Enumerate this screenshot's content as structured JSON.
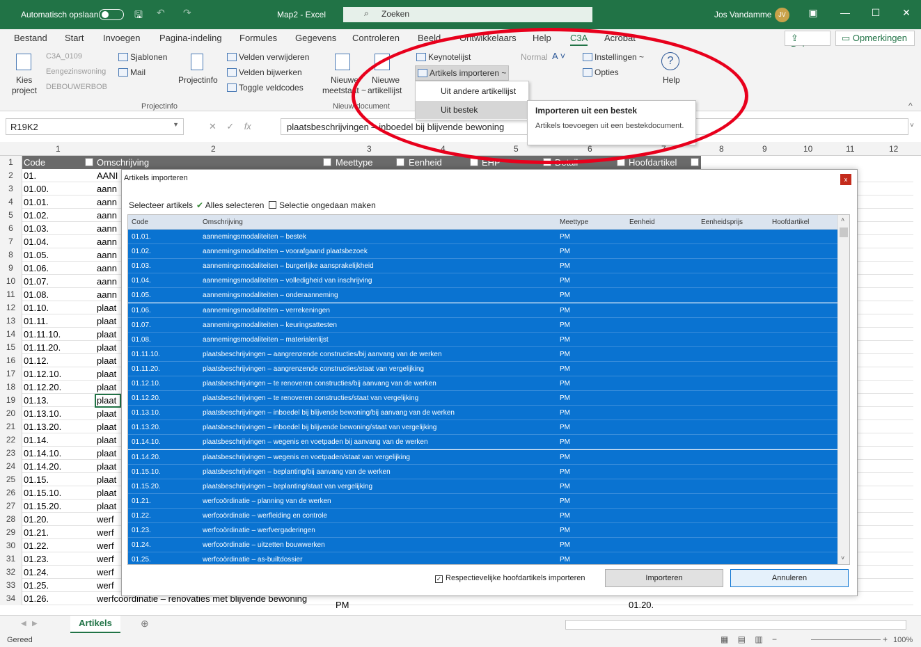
{
  "titlebar": {
    "autosave": "Automatisch opslaan",
    "filename": "Map2 - Excel",
    "search": "Zoeken",
    "user": "Jos Vandamme",
    "initials": "JV"
  },
  "menu": [
    "Bestand",
    "Start",
    "Invoegen",
    "Pagina-indeling",
    "Formules",
    "Gegevens",
    "Controleren",
    "Beeld",
    "Ontwikkelaars",
    "Help",
    "C3A",
    "Acrobat"
  ],
  "share": "Delen",
  "comments": "Opmerkingen",
  "ribbon": {
    "kies": "Kies",
    "project": "project",
    "proj_lines": [
      "C3A_0109",
      "Eengezinswoning",
      "DEBOUWERBOB"
    ],
    "sjablonen": "Sjablonen",
    "mail": "Mail",
    "projectinfo": "Projectinfo",
    "velden_verwijderen": "Velden verwijderen",
    "velden_bijwerken": "Velden bijwerken",
    "toggle": "Toggle veldcodes",
    "grp_projectinfo": "Projectinfo",
    "nieuwe_meetstaat": [
      "Nieuwe",
      "meetstaat ~"
    ],
    "nieuwe_artikellijst": [
      "Nieuwe",
      "artikellijst"
    ],
    "grp_nieuw": "Nieuw document",
    "keynotelijst": "Keynotelijst",
    "artikels_importeren": "Artikels importeren ~",
    "normal": "Normal",
    "instellingen": "Instellingen ~",
    "opties": "Opties",
    "help": "Help"
  },
  "dropdown": [
    "Uit andere artikellijst",
    "Uit bestek"
  ],
  "tooltip": {
    "title": "Importeren uit een bestek",
    "body": "Artikels toevoegen uit een bestekdocument."
  },
  "formula": {
    "namebox": "R19K2",
    "content": "plaatsbeschrijvingen – inboedel bij blijvende bewoning"
  },
  "columns": [
    "1",
    "2",
    "3",
    "4",
    "5",
    "6",
    "7",
    "8",
    "9",
    "10",
    "11",
    "12"
  ],
  "headers": [
    "Code",
    "Omschrijving",
    "Meettype",
    "Eenheid",
    "EHP",
    "Detail",
    "Hoofdartikel"
  ],
  "rows": [
    [
      "01.",
      "AANI"
    ],
    [
      "01.00.",
      "aann"
    ],
    [
      "01.01.",
      "aann"
    ],
    [
      "01.02.",
      "aann"
    ],
    [
      "01.03.",
      "aann"
    ],
    [
      "01.04.",
      "aann"
    ],
    [
      "01.05.",
      "aann"
    ],
    [
      "01.06.",
      "aann"
    ],
    [
      "01.07.",
      "aann"
    ],
    [
      "01.08.",
      "aann"
    ],
    [
      "01.10.",
      "plaat"
    ],
    [
      "01.11.",
      "plaat"
    ],
    [
      "01.11.10.",
      "plaat"
    ],
    [
      "01.11.20.",
      "plaat"
    ],
    [
      "01.12.",
      "plaat"
    ],
    [
      "01.12.10.",
      "plaat"
    ],
    [
      "01.12.20.",
      "plaat"
    ],
    [
      "01.13.",
      "plaat"
    ],
    [
      "01.13.10.",
      "plaat"
    ],
    [
      "01.13.20.",
      "plaat"
    ],
    [
      "01.14.",
      "plaat"
    ],
    [
      "01.14.10.",
      "plaat"
    ],
    [
      "01.14.20.",
      "plaat"
    ],
    [
      "01.15.",
      "plaat"
    ],
    [
      "01.15.10.",
      "plaat"
    ],
    [
      "01.15.20.",
      "plaat"
    ],
    [
      "01.20.",
      "werf"
    ],
    [
      "01.21.",
      "werf"
    ],
    [
      "01.22.",
      "werf"
    ],
    [
      "01.23.",
      "werf"
    ],
    [
      "01.24.",
      "werf"
    ],
    [
      "01.25.",
      "werf"
    ],
    [
      "01.26.",
      "werfcoördinatie – renovaties met blijvende bewoning"
    ]
  ],
  "row34": {
    "meettype": "PM",
    "hoofd": "01.20."
  },
  "sheet": {
    "tab": "Artikels",
    "status": "Gereed",
    "zoom": "100%"
  },
  "dialog": {
    "title": "Artikels importeren",
    "close": "x",
    "selecteer": "Selecteer artikels",
    "alles": "Alles selecteren",
    "ongedaan": "Selectie ongedaan maken",
    "cols": [
      "Code",
      "Omschrijving",
      "Meettype",
      "Eenheid",
      "Eenheidsprijs",
      "Hoofdartikel"
    ],
    "items": [
      [
        "01.01.",
        "aannemingsmodaliteiten – bestek",
        "PM"
      ],
      [
        "01.02.",
        "aannemingsmodaliteiten – voorafgaand plaatsbezoek",
        "PM"
      ],
      [
        "01.03.",
        "aannemingsmodaliteiten – burgerlijke aansprakelijkheid",
        "PM"
      ],
      [
        "01.04.",
        "aannemingsmodaliteiten – volledigheid van inschrijving",
        "PM"
      ],
      [
        "01.05.",
        "aannemingsmodaliteiten – onderaanneming",
        "PM"
      ],
      [
        "01.06.",
        "aannemingsmodaliteiten – verrekeningen",
        "PM"
      ],
      [
        "01.07.",
        "aannemingsmodaliteiten – keuringsattesten",
        "PM"
      ],
      [
        "01.08.",
        "aannemingsmodaliteiten – materialenlijst",
        "PM"
      ],
      [
        "01.11.10.",
        "plaatsbeschrijvingen – aangrenzende constructies/bij aanvang van de werken",
        "PM"
      ],
      [
        "01.11.20.",
        "plaatsbeschrijvingen – aangrenzende constructies/staat van vergelijking",
        "PM"
      ],
      [
        "01.12.10.",
        "plaatsbeschrijvingen – te renoveren constructies/bij aanvang van de werken",
        "PM"
      ],
      [
        "01.12.20.",
        "plaatsbeschrijvingen – te renoveren constructies/staat van vergelijking",
        "PM"
      ],
      [
        "01.13.10.",
        "plaatsbeschrijvingen – inboedel bij blijvende bewoning/bij aanvang van de werken",
        "PM"
      ],
      [
        "01.13.20.",
        "plaatsbeschrijvingen – inboedel bij blijvende bewoning/staat van vergelijking",
        "PM"
      ],
      [
        "01.14.10.",
        "plaatsbeschrijvingen – wegenis en voetpaden bij aanvang van de werken",
        "PM"
      ],
      [
        "01.14.20.",
        "plaatsbeschrijvingen – wegenis en voetpaden/staat van vergelijking",
        "PM"
      ],
      [
        "01.15.10.",
        "plaatsbeschrijvingen – beplanting/bij aanvang van de werken",
        "PM"
      ],
      [
        "01.15.20.",
        "plaatsbeschrijvingen – beplanting/staat van vergelijking",
        "PM"
      ],
      [
        "01.21.",
        "werfcoördinatie – planning van de werken",
        "PM"
      ],
      [
        "01.22.",
        "werfcoördinatie – werfleiding en controle",
        "PM"
      ],
      [
        "01.23.",
        "werfcoördinatie – werfvergaderingen",
        "PM"
      ],
      [
        "01.24.",
        "werfcoördinatie – uitzetten bouwwerken",
        "PM"
      ],
      [
        "01.25.",
        "werfcoördinatie – as-builtdossier",
        "PM"
      ]
    ],
    "checkbox": "Respectievelijke hoofdartikels importeren",
    "importeren": "Importeren",
    "annuleren": "Annuleren"
  }
}
